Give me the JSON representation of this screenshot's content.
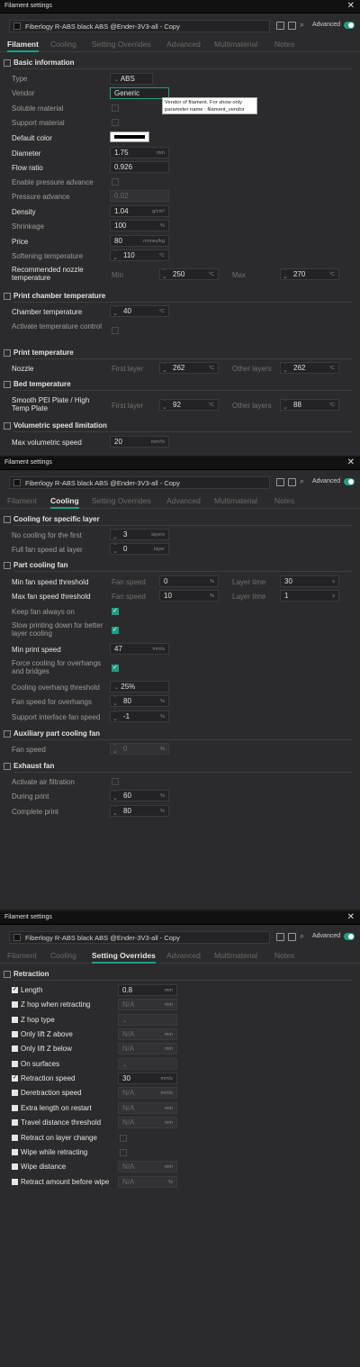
{
  "window_title": "Filament settings",
  "preset_name": "Fiberlogy R-ABS black ABS @Ender-3V3-all - Copy",
  "advanced_label": "Advanced",
  "tabs": [
    "Filament",
    "Cooling",
    "Setting Overrides",
    "Advanced",
    "Multimaterial",
    "Notes"
  ],
  "accent_color": "#1f9e83",
  "panel1": {
    "basic_title": "Basic information",
    "type_label": "Type",
    "type_value": "ABS",
    "vendor_label": "Vendor",
    "vendor_value": "Generic",
    "tooltip_line1": "Vendor of filament. For show only",
    "tooltip_line2": "parameter name    : filament_vendor",
    "soluble_label": "Soluble material",
    "support_label": "Support material",
    "color_label": "Default color",
    "diameter_label": "Diameter",
    "diameter_value": "1.75",
    "diameter_unit": "mm",
    "flow_label": "Flow ratio",
    "flow_value": "0.926",
    "pa_enable_label": "Enable pressure advance",
    "pa_label": "Pressure advance",
    "pa_value": "0.02",
    "density_label": "Density",
    "density_value": "1.04",
    "density_unit": "g/cm³",
    "shrink_label": "Shrinkage",
    "shrink_value": "100",
    "shrink_unit": "%",
    "price_label": "Price",
    "price_value": "80",
    "price_unit": "money/kg",
    "soft_label": "Softening temperature",
    "soft_value": "110",
    "soft_unit": "°C",
    "rec_label": "Recommended nozzle temperature",
    "min_label": "Min",
    "min_value": "250",
    "max_label": "Max",
    "max_value": "270",
    "temp_unit": "°C",
    "chamber_title": "Print chamber temperature",
    "chamber_label": "Chamber temperature",
    "chamber_value": "40",
    "act_temp_label": "Activate temperature control",
    "print_temp_title": "Print temperature",
    "nozzle_label": "Nozzle",
    "first_layer_label": "First layer",
    "other_layers_label": "Other layers",
    "nozzle_first": "262",
    "nozzle_other": "262",
    "bed_title": "Bed temperature",
    "bed_label": "Smooth PEI Plate / High Temp Plate",
    "bed_first": "92",
    "bed_other": "88",
    "vol_title": "Volumetric speed limitation",
    "vol_label": "Max volumetric speed",
    "vol_value": "20",
    "vol_unit": "mm³/s"
  },
  "panel2": {
    "layer_title": "Cooling for specific layer",
    "no_cool_label": "No cooling for the first",
    "no_cool_value": "3",
    "layers_unit": "layers",
    "full_fan_label": "Full fan speed at layer",
    "full_fan_value": "0",
    "layer_unit": "layer",
    "part_title": "Part cooling fan",
    "min_fan_label": "Min fan speed threshold",
    "max_fan_label": "Max fan speed threshold",
    "fan_speed_label": "Fan speed",
    "layer_time_label": "Layer time",
    "min_fan_speed": "0",
    "min_layer_time": "30",
    "max_fan_speed": "10",
    "max_layer_time": "1",
    "pct_unit": "%",
    "s_unit": "s",
    "keep_fan_label": "Keep fan always on",
    "slow_label": "Slow printing down for better layer cooling",
    "min_print_label": "Min print speed",
    "min_print_value": "47",
    "speed_unit": "mm/s",
    "force_label": "Force cooling for overhangs and bridges",
    "threshold_label": "Cooling overhang threshold",
    "threshold_value": "25%",
    "overhang_fan_label": "Fan speed for overhangs",
    "overhang_fan_value": "80",
    "support_fan_label": "Support interface fan speed",
    "support_fan_value": "-1",
    "aux_title": "Auxiliary part cooling fan",
    "aux_fan_label": "Fan speed",
    "aux_fan_value": "0",
    "exhaust_title": "Exhaust fan",
    "air_filter_label": "Activate air filtration",
    "during_label": "During print",
    "during_value": "60",
    "complete_label": "Complete print",
    "complete_value": "80"
  },
  "panel3": {
    "retraction_title": "Retraction",
    "na": "N/A",
    "rows": [
      {
        "label": "Length",
        "checked": true,
        "value": "0.8",
        "unit": "mm",
        "kind": "field"
      },
      {
        "label": "Z hop when retracting",
        "checked": false,
        "value": "N/A",
        "unit": "mm",
        "kind": "field"
      },
      {
        "label": "Z hop type",
        "checked": false,
        "value": "",
        "unit": "",
        "kind": "combo"
      },
      {
        "label": "Only lift Z above",
        "checked": false,
        "value": "N/A",
        "unit": "mm",
        "kind": "field"
      },
      {
        "label": "Only lift Z below",
        "checked": false,
        "value": "N/A",
        "unit": "mm",
        "kind": "field"
      },
      {
        "label": "On surfaces",
        "checked": false,
        "value": "",
        "unit": "",
        "kind": "combo"
      },
      {
        "label": "Retraction speed",
        "checked": true,
        "value": "30",
        "unit": "mm/s",
        "kind": "field"
      },
      {
        "label": "Deretraction speed",
        "checked": false,
        "value": "N/A",
        "unit": "mm/s",
        "kind": "field"
      },
      {
        "label": "Extra length on restart",
        "checked": false,
        "value": "N/A",
        "unit": "mm",
        "kind": "field"
      },
      {
        "label": "Travel distance threshold",
        "checked": false,
        "value": "N/A",
        "unit": "mm",
        "kind": "field"
      },
      {
        "label": "Retract on layer change",
        "checked": false,
        "value": "",
        "unit": "",
        "kind": "check"
      },
      {
        "label": "Wipe while retracting",
        "checked": false,
        "value": "",
        "unit": "",
        "kind": "check"
      },
      {
        "label": "Wipe distance",
        "checked": false,
        "value": "N/A",
        "unit": "mm",
        "kind": "field"
      },
      {
        "label": "Retract amount before wipe",
        "checked": false,
        "value": "N/A",
        "unit": "%",
        "kind": "field"
      }
    ]
  }
}
